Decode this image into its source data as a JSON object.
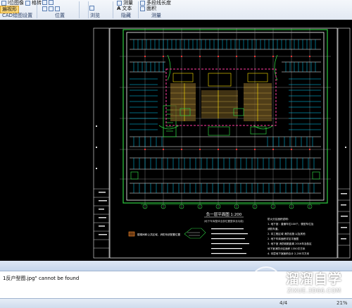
{
  "ribbon": {
    "items": {
      "top_left_a": "l位图像",
      "selected": "遍视形",
      "top_left_b": "格转",
      "measure": "测量",
      "text": "文本",
      "area": "面积",
      "multi_measure": "多段线长度"
    },
    "groups": {
      "cad_settings": "CAD绘图设置",
      "position": "位置",
      "browse": "浏览",
      "hide": "隐藏",
      "measure": "测量"
    }
  },
  "drawing": {
    "title": "负一层平面图  1:200",
    "subtitle": "(地下车库整体全部位置整体及功能)",
    "note_left": "楼梯间和公共区域、消防系统配置位置",
    "notes_right": [
      "防火分区面积说明：",
      "1. 地下室：普通车位100个，微型车位及",
      "   消防车道。",
      "2. 本工程区域 消防设施 以及其他",
      "   2. 地下车库面积详见平面图",
      "3. 地下室 消防疏散距离 2016年及各区",
      "   地下室消防分区面积 1350平方米",
      "4. 本层地下室面积合计  2,200平方米"
    ],
    "colors": {
      "line_white": "#ffffff",
      "line_green": "#2ecc40",
      "line_cyan": "#00d4ff",
      "line_red": "#ff3333",
      "line_yellow": "#ffe100",
      "line_magenta": "#ff3ca0",
      "line_grey": "#9a9a9a",
      "hatch": "#d9b34a"
    }
  },
  "message": "1反户型图.jpg\" cannot be found",
  "status": {
    "page": "4/4",
    "zoom": "21%"
  },
  "watermark": {
    "title": "溜溜自学",
    "url": "ZIXUE.3D66.COM"
  }
}
